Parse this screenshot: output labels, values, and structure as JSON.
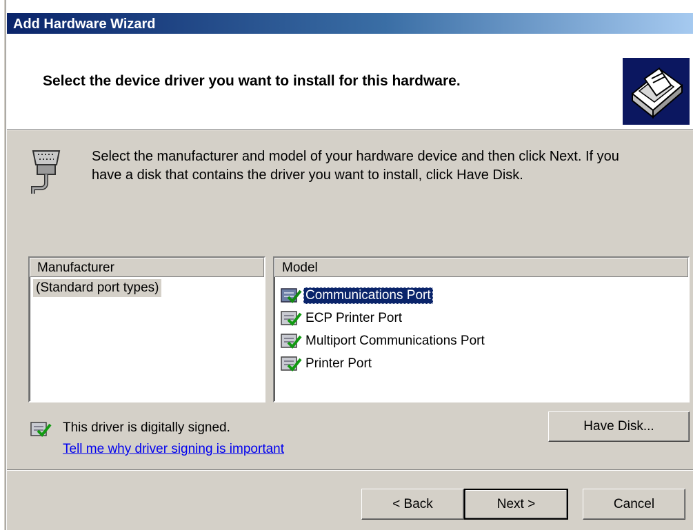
{
  "window": {
    "title": "Add Hardware Wizard"
  },
  "header": {
    "title": "Select the device driver you want to install for this hardware."
  },
  "intro": {
    "line1": "Select the manufacturer and model of your hardware device and then click Next. If you",
    "line2": "have a disk that contains the driver you want to install, click Have Disk."
  },
  "manufacturer": {
    "header": "Manufacturer",
    "items": [
      "(Standard port types)"
    ],
    "selected": "(Standard port types)"
  },
  "model": {
    "header": "Model",
    "items": [
      "Communications Port",
      "ECP Printer Port",
      "Multiport Communications Port",
      "Printer Port"
    ],
    "selected": "Communications Port"
  },
  "signing": {
    "status": "This driver is digitally signed.",
    "link": "Tell me why driver signing is important"
  },
  "buttons": {
    "have_disk": "Have Disk...",
    "back": "< Back",
    "next": "Next >",
    "cancel": "Cancel"
  },
  "icons": {
    "header": "hardware-wizard-icon",
    "intro": "serial-port-icon",
    "driver": "signed-driver-icon"
  },
  "colors": {
    "titlebar": "#0a246a",
    "dialog": "#d4d0c8",
    "selection": "#0a246a",
    "link": "#0000ee"
  }
}
